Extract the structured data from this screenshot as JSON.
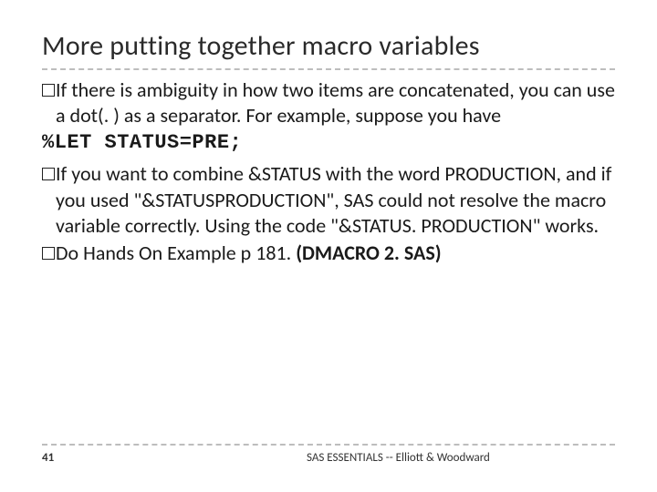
{
  "title": "More putting together macro variables",
  "bullets": {
    "b1_lead": "If",
    "b1_rest": " there is ambiguity in how two items are concatenated, you can use a dot(. ) as a separator. For example, suppose you have",
    "code1": "%LET STATUS=PRE;",
    "b2_lead": "If",
    "b2_rest": " you want to combine &STATUS with the word PRODUCTION, and if you used \"&STATUSPRODUCTION\", SAS could not resolve the macro variable correctly. Using the code \"&STATUS. PRODUCTION\" works.",
    "b3_lead": "Do",
    "b3_rest": " Hands On Example p 181. ",
    "b3_bold": "(DMACRO 2. SAS)"
  },
  "footer": {
    "page": "41",
    "attribution": "SAS ESSENTIALS -- Elliott & Woodward"
  }
}
